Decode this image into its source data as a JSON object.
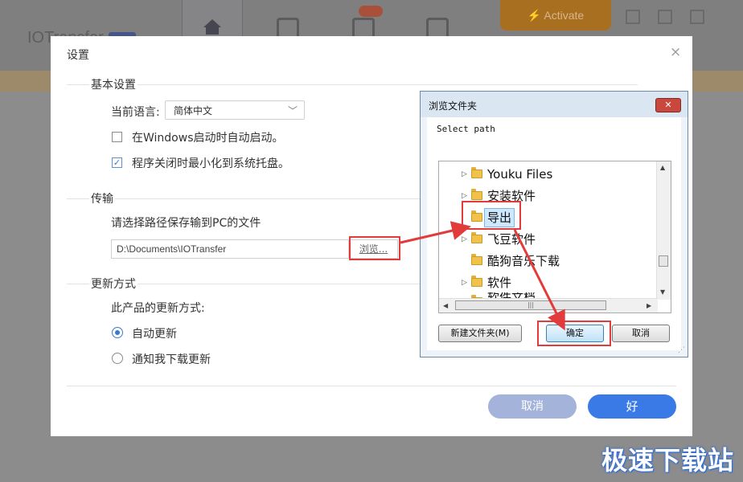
{
  "background_app": {
    "logo_text": "IOTransfer",
    "activate_label": "Activate"
  },
  "settings_dialog": {
    "title": "设置",
    "close_icon": "×",
    "basic": {
      "heading": "基本设置",
      "language_label": "当前语言:",
      "language_value": "简体中文",
      "autostart_label": "在Windows启动时自动启动。",
      "autostart_checked": false,
      "minimize_tray_label": "程序关闭时最小化到系统托盘。",
      "minimize_tray_checked": true
    },
    "transfer": {
      "heading": "传输",
      "path_prompt": "请选择路径保存输到PC的文件",
      "path_value": "D:\\Documents\\IOTransfer",
      "browse_label": "浏览..."
    },
    "update": {
      "heading": "更新方式",
      "prompt": "此产品的更新方式:",
      "auto_label": "自动更新",
      "notify_label": "通知我下载更新",
      "selected": "auto"
    },
    "cancel_label": "取消",
    "ok_label": "好"
  },
  "browse_dialog": {
    "title": "浏览文件夹",
    "instruction": "Select path",
    "tree": [
      {
        "label": "Youku Files",
        "has_children": true,
        "selected": false
      },
      {
        "label": "安装软件",
        "has_children": true,
        "selected": false
      },
      {
        "label": "导出",
        "has_children": false,
        "selected": true
      },
      {
        "label": "飞豆软件",
        "has_children": true,
        "selected": false
      },
      {
        "label": "酷狗音乐下载",
        "has_children": false,
        "selected": false
      },
      {
        "label": "软件",
        "has_children": true,
        "selected": false
      },
      {
        "label": "软件文档",
        "has_children": false,
        "selected": false
      }
    ],
    "new_folder_label": "新建文件夹(M)",
    "ok_label": "确定",
    "cancel_label": "取消"
  },
  "colors": {
    "accent": "#3a7ae6",
    "cancel_button": "#a3b3d9",
    "annotation": "#e23b3b"
  },
  "watermark": "极速下载站"
}
